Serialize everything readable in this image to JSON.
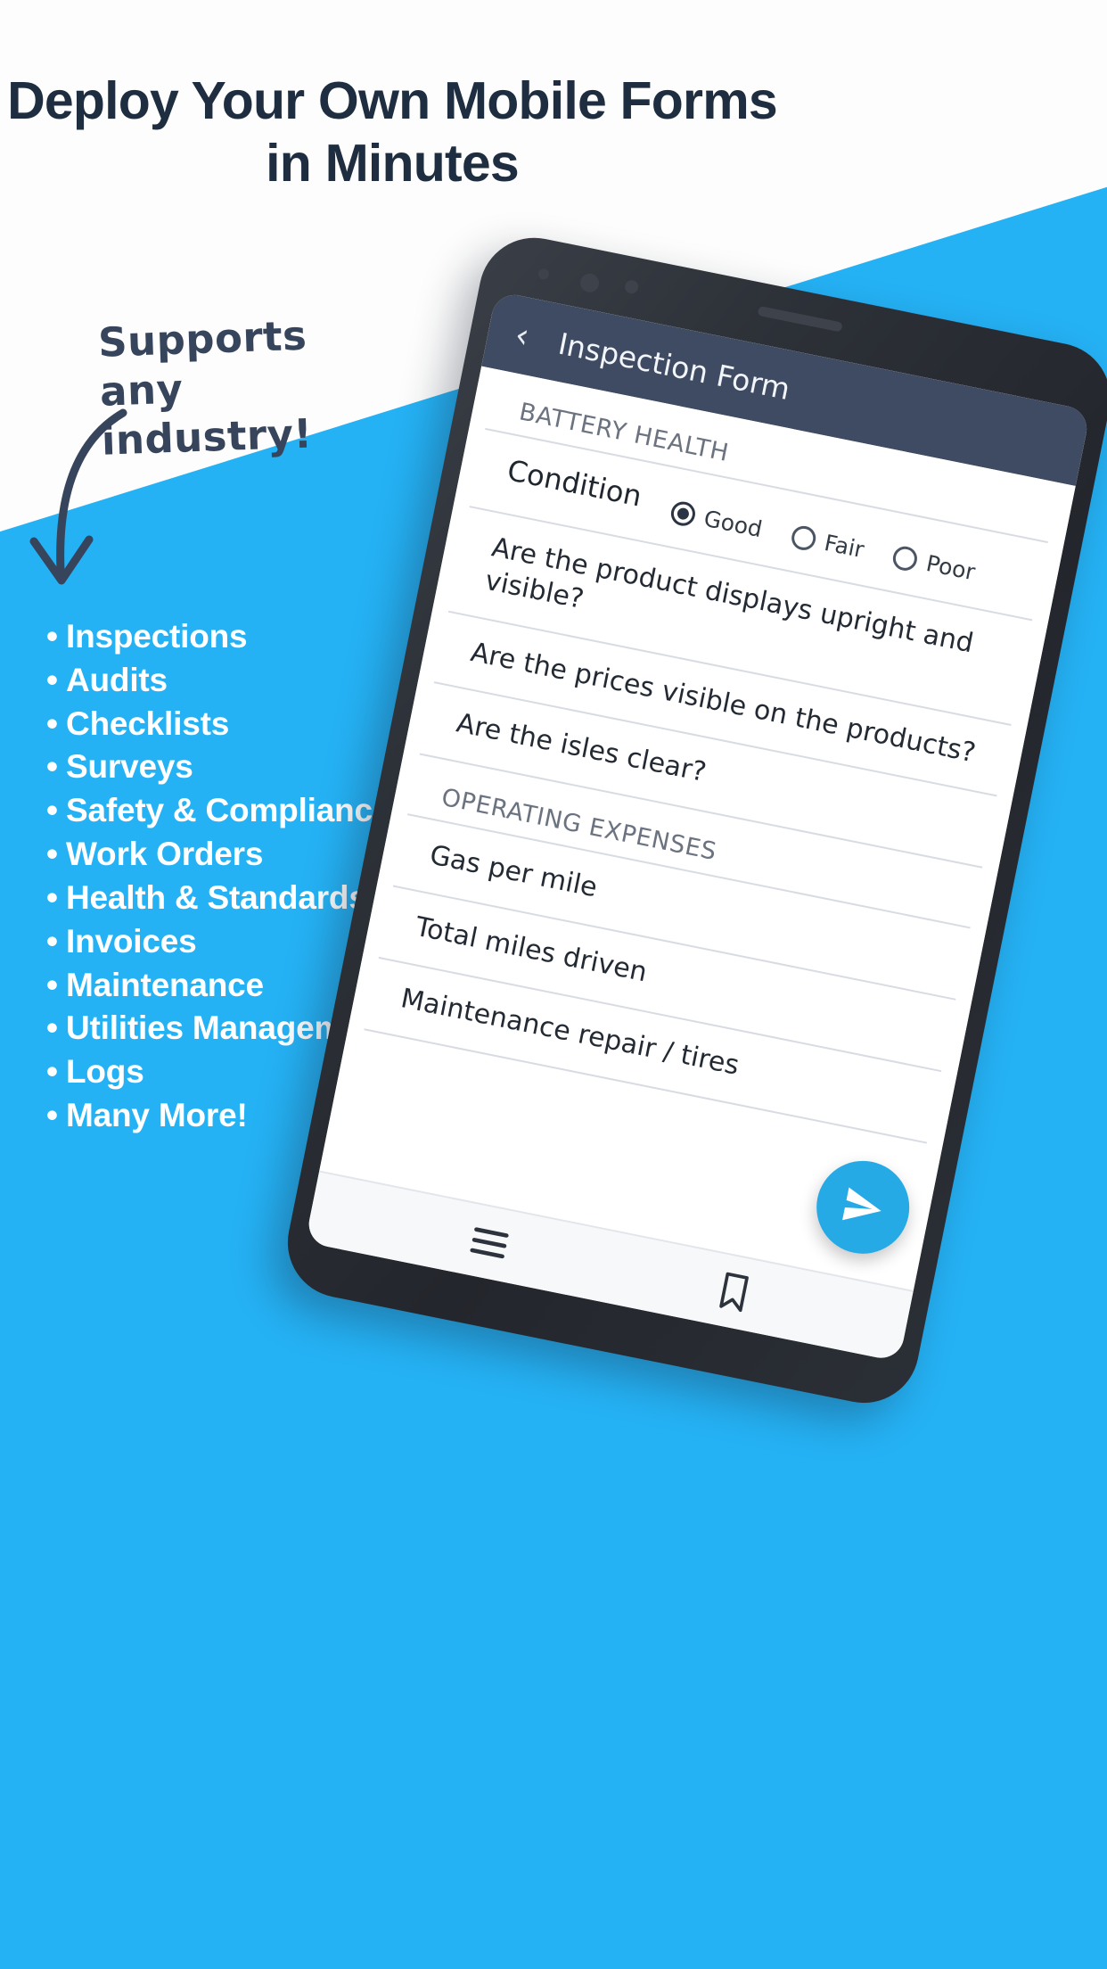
{
  "colors": {
    "brand_blue": "#25b2f5",
    "dark_navy": "#1e2d40",
    "appbar": "#3f4b63",
    "fab": "#26aae6",
    "white": "#ffffff"
  },
  "headline": "Deploy Your Own Mobile Forms in Minutes",
  "handwritten_note": "Supports any industry!",
  "arrow_icon": "curved-down-arrow-icon",
  "bullets": [
    {
      "bullet": "•",
      "label": "Inspections"
    },
    {
      "bullet": "•",
      "label": "Audits"
    },
    {
      "bullet": "•",
      "label": "Checklists"
    },
    {
      "bullet": "•",
      "label": "Surveys"
    },
    {
      "bullet": "•",
      "label": "Safety & Compliance"
    },
    {
      "bullet": "•",
      "label": "Work Orders"
    },
    {
      "bullet": "•",
      "label": "Health & Standards"
    },
    {
      "bullet": "•",
      "label": "Invoices"
    },
    {
      "bullet": "•",
      "label": "Maintenance"
    },
    {
      "bullet": "•",
      "label": "Utilities Management"
    },
    {
      "bullet": "•",
      "label": "Logs"
    },
    {
      "bullet": "•",
      "label": "Many More!"
    }
  ],
  "phone": {
    "appbar": {
      "back_icon": "chevron-left-icon",
      "title": "Inspection Form"
    },
    "form": {
      "section_battery": "BATTERY HEALTH",
      "condition_label": "Condition",
      "condition_options": [
        {
          "label": "Good",
          "selected": true
        },
        {
          "label": "Fair",
          "selected": false
        },
        {
          "label": "Poor",
          "selected": false
        }
      ],
      "questions": [
        "Are the product displays upright and visible?",
        "Are the prices visible on the products?",
        "Are the isles clear?"
      ],
      "section_expenses": "OPERATING EXPENSES",
      "expense_fields": [
        "Gas per mile",
        "Total miles driven",
        "Maintenance repair / tires"
      ]
    },
    "fab_icon": "send-icon",
    "bottom_bar": [
      {
        "icon": "menu-icon"
      },
      {
        "icon": "bookmark-icon"
      }
    ]
  }
}
